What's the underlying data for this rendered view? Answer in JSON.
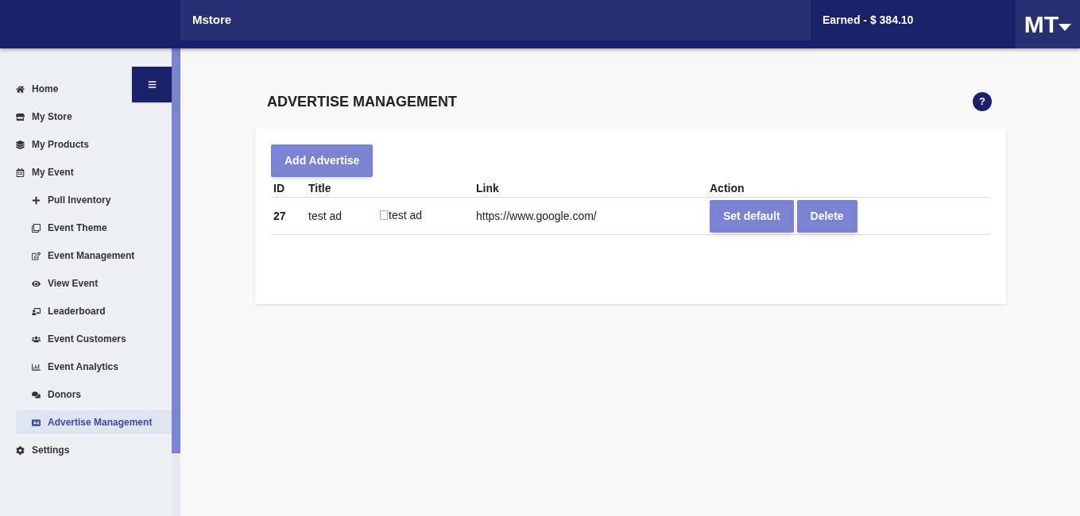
{
  "header": {
    "brand": "Mstore",
    "earned": "Earned - $ 384.10",
    "avatar": "MT"
  },
  "sidebar": {
    "items": [
      {
        "label": "Home",
        "selected": false
      },
      {
        "label": "My Store",
        "selected": false
      },
      {
        "label": "My Products",
        "selected": false
      },
      {
        "label": "My Event",
        "selected": false,
        "children": [
          {
            "label": "Pull Inventory",
            "selected": false
          },
          {
            "label": "Event Theme",
            "selected": false
          },
          {
            "label": "Event Management",
            "selected": false
          },
          {
            "label": "View Event",
            "selected": false
          },
          {
            "label": "Leaderboard",
            "selected": false
          },
          {
            "label": "Event Customers",
            "selected": false
          },
          {
            "label": "Event Analytics",
            "selected": false
          },
          {
            "label": "Donors",
            "selected": false
          },
          {
            "label": "Advertise Management",
            "selected": true
          }
        ]
      },
      {
        "label": "Settings",
        "selected": false
      }
    ]
  },
  "page": {
    "title": "ADVERTISE MANAGEMENT",
    "help": "?",
    "add_button": "Add Advertise",
    "table": {
      "columns": [
        "ID",
        "Title",
        "",
        "Link",
        "Action"
      ],
      "rows": [
        {
          "id": "27",
          "title": "test ad",
          "image_alt": "test ad",
          "link": "https://www.google.com/",
          "actions": [
            "Set default",
            "Delete"
          ]
        }
      ]
    }
  }
}
